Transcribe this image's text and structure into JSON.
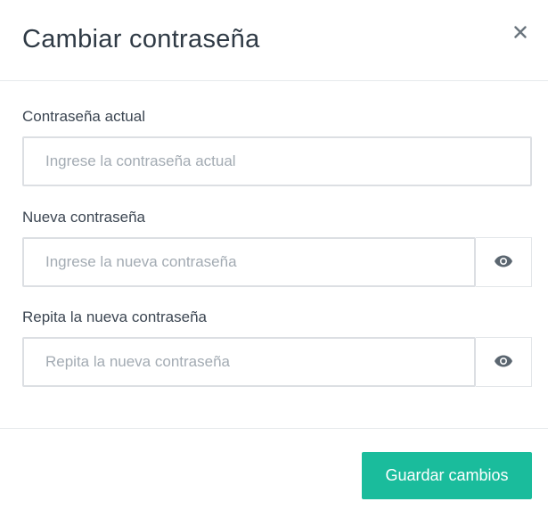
{
  "modal": {
    "title": "Cambiar contraseña",
    "close_icon": "close-icon"
  },
  "fields": {
    "current_password": {
      "label": "Contraseña actual",
      "placeholder": "Ingrese la contraseña actual",
      "value": ""
    },
    "new_password": {
      "label": "Nueva contraseña",
      "placeholder": "Ingrese la nueva contraseña",
      "value": "",
      "toggle_icon": "eye-icon"
    },
    "repeat_password": {
      "label": "Repita la nueva contraseña",
      "placeholder": "Repita la nueva contraseña",
      "value": "",
      "toggle_icon": "eye-icon"
    }
  },
  "footer": {
    "save_label": "Guardar cambios"
  },
  "colors": {
    "accent": "#1abc9c",
    "title_text": "#2f3a45",
    "placeholder_text": "#a3abb3",
    "input_border": "#dcdfe3",
    "icon": "#5b6670"
  }
}
